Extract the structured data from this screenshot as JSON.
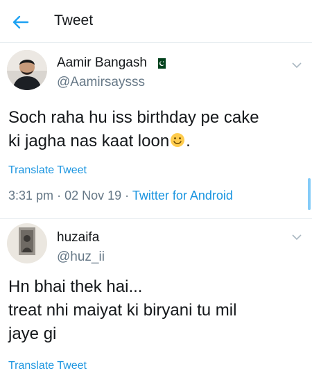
{
  "header": {
    "title": "Tweet",
    "back_icon": "back-arrow-icon"
  },
  "colors": {
    "accent": "#1b95e0",
    "text": "#14171a",
    "muted": "#657786",
    "divider": "#e6ecf0"
  },
  "tweets": [
    {
      "display_name": "Aamir Bangash",
      "handle": "@Aamirsaysss",
      "text_line1": "Soch raha hu iss birthday pe cake",
      "text_line2_before_emoji": "ki jagha nas kaat loon",
      "text_line2_after_emoji": ".",
      "emoji": "smiling-face-emoji",
      "translate_label": "Translate Tweet",
      "time": "3:31 pm",
      "date": "02 Nov 19",
      "source": "Twitter for Android",
      "sep": "·"
    },
    {
      "display_name": "huzaifa",
      "handle": "@huz_ii",
      "text": "Hn bhai thek hai...\n treat nhi maiyat ki biryani tu mil\njaye gi",
      "translate_label": "Translate Tweet"
    }
  ]
}
